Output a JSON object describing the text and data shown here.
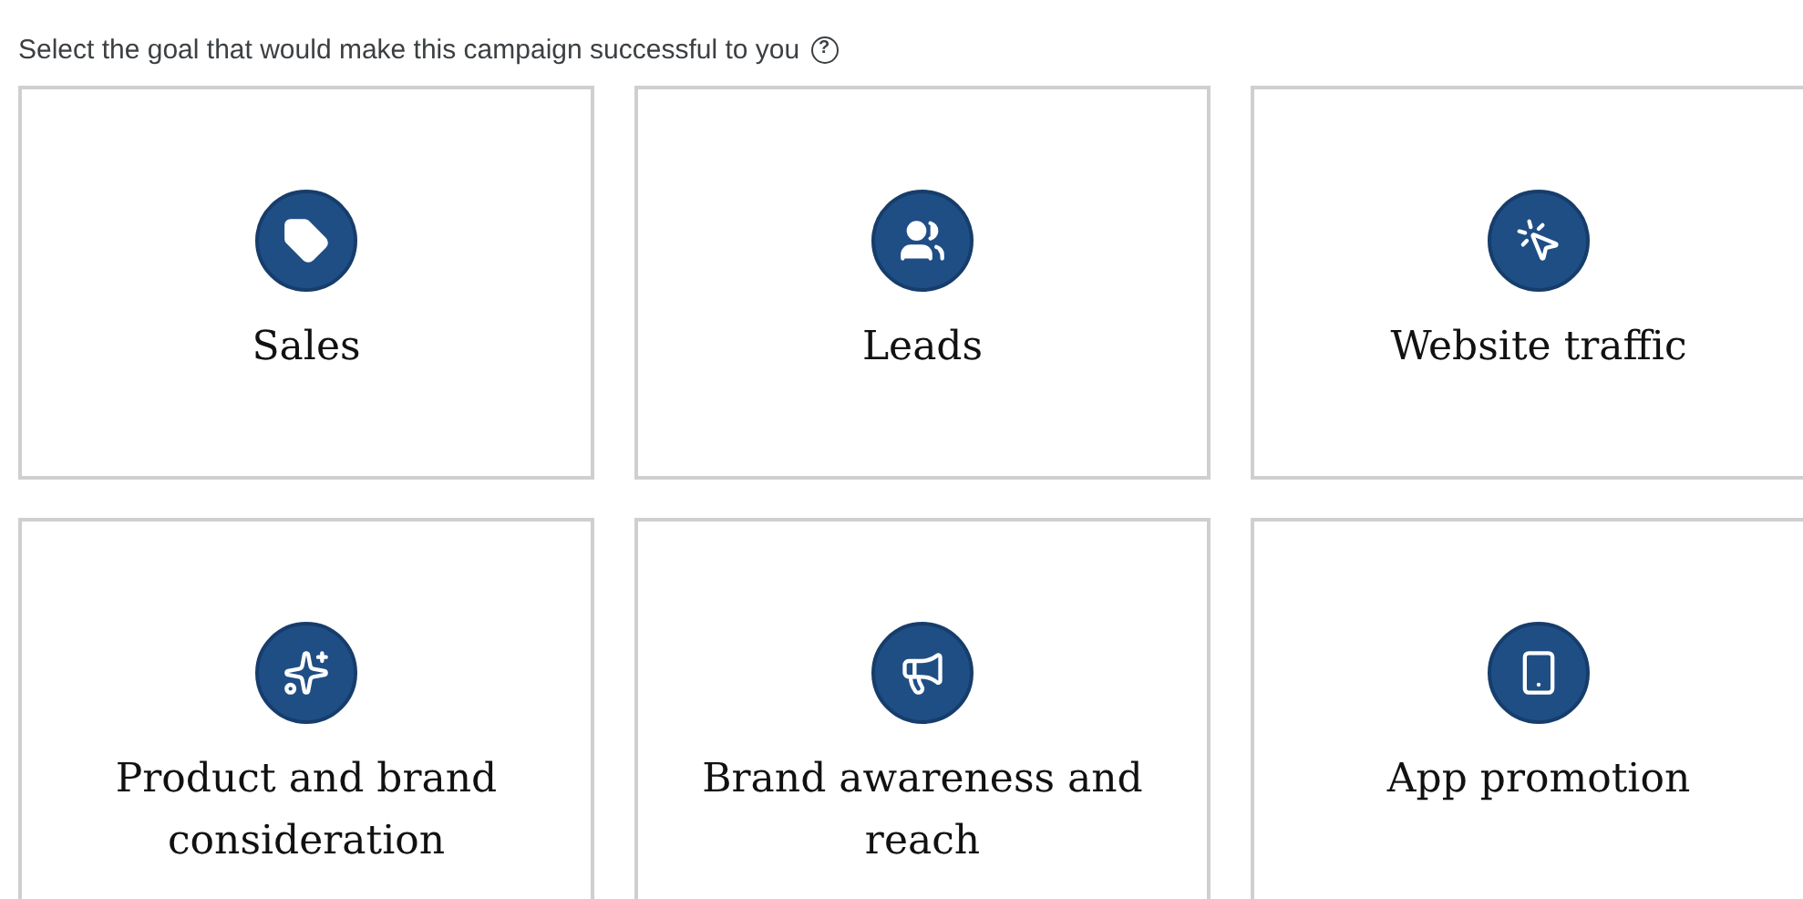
{
  "heading": {
    "text": "Select the goal that would make this campaign successful to you",
    "help": "?"
  },
  "goals": [
    {
      "label": "Sales",
      "selected": false
    },
    {
      "label": "Leads",
      "selected": false
    },
    {
      "label": "Website traffic",
      "selected": false
    },
    {
      "label": "Product and brand consideration",
      "selected": false
    },
    {
      "label": "Brand awareness and reach",
      "selected": false
    },
    {
      "label": "App promotion",
      "selected": false
    }
  ]
}
